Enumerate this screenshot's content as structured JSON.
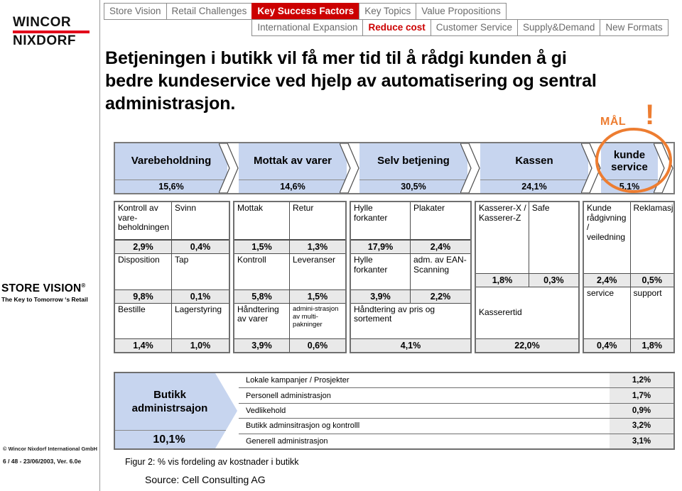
{
  "brand": {
    "logo_line1": "WINCOR",
    "logo_line2": "NIXDORF",
    "store_vision": "STORE VISION",
    "store_vision_mark": "®",
    "store_vision_tagline": "The Key to Tomorrow ‘s Retail",
    "copyright": "© Wincor Nixdorf International GmbH",
    "version": "6 / 48 - 23/06/2003, Ver. 6.0e",
    "accent_red": "#cc0000",
    "accent_orange": "#ED7D31",
    "chevron_blue": "#c7d5ef"
  },
  "tabs": {
    "row1": [
      {
        "label": "Store Vision",
        "state": "normal"
      },
      {
        "label": "Retail Challenges",
        "state": "normal"
      },
      {
        "label": "Key Success Factors",
        "state": "active"
      },
      {
        "label": "Key Topics",
        "state": "normal"
      },
      {
        "label": "Value Propositions",
        "state": "normal"
      }
    ],
    "row2": [
      {
        "label": "International Expansion",
        "state": "normal"
      },
      {
        "label": "Reduce cost",
        "state": "active-text"
      },
      {
        "label": "Customer Service",
        "state": "normal"
      },
      {
        "label": "Supply&Demand",
        "state": "normal"
      },
      {
        "label": "New Formats",
        "state": "normal"
      }
    ]
  },
  "headline": "Betjeningen i butikk vil få mer tid til å rådgi kunden å gi bedre kundeservice ved hjelp av automatisering og sentral administrasjon.",
  "target": {
    "label": "MÅL",
    "exclamation": "!"
  },
  "chart_data": {
    "type": "bar",
    "title": "Figur 2: % vis fordeling av kostnader i butikk",
    "source": "Source: Cell Consulting AG",
    "units": "percent of in-store cost",
    "categories": [
      "Varebeholdning",
      "Mottak av varer",
      "Selv betjening",
      "Kassen",
      "kunde service",
      "Butikk administrsajon"
    ],
    "values": [
      15.6,
      14.6,
      30.5,
      24.1,
      5.1,
      10.1
    ],
    "value_labels": [
      "15,6%",
      "14,6%",
      "30,5%",
      "24,1%",
      "5,1%",
      "10,1%"
    ],
    "xlabel": "",
    "ylabel": "",
    "breakdown": [
      {
        "group": "Varebeholdning",
        "item": "Kontroll av vare-beholdningen",
        "value": 2.9,
        "label": "2,9%"
      },
      {
        "group": "Varebeholdning",
        "item": "Svinn",
        "value": 0.4,
        "label": "0,4%"
      },
      {
        "group": "Varebeholdning",
        "item": "Disposition",
        "value": 9.8,
        "label": "9,8%"
      },
      {
        "group": "Varebeholdning",
        "item": "Tap",
        "value": 0.1,
        "label": "0,1%"
      },
      {
        "group": "Varebeholdning",
        "item": "Bestille",
        "value": 1.4,
        "label": "1,4%"
      },
      {
        "group": "Varebeholdning",
        "item": "Lagerstyring",
        "value": 1.0,
        "label": "1,0%"
      },
      {
        "group": "Mottak av varer",
        "item": "Mottak",
        "value": 1.5,
        "label": "1,5%"
      },
      {
        "group": "Mottak av varer",
        "item": "Retur",
        "value": 1.3,
        "label": "1,3%"
      },
      {
        "group": "Mottak av varer",
        "item": "Kontroll",
        "value": 5.8,
        "label": "5,8%"
      },
      {
        "group": "Mottak av varer",
        "item": "Leveranser",
        "value": 1.5,
        "label": "1,5%"
      },
      {
        "group": "Mottak av varer",
        "item": "Håndtering av varer",
        "value": 3.9,
        "label": "3,9%"
      },
      {
        "group": "Mottak av varer",
        "item": "admini-strasjon av multi-pakninger",
        "value": 0.6,
        "label": "0,6%"
      },
      {
        "group": "Selv betjening",
        "item": "Hylle forkanter",
        "value": 17.9,
        "label": "17,9%"
      },
      {
        "group": "Selv betjening",
        "item": "Plakater",
        "value": 2.4,
        "label": "2,4%"
      },
      {
        "group": "Selv betjening",
        "item": "Hylle forkanter",
        "value": 3.9,
        "label": "3,9%"
      },
      {
        "group": "Selv betjening",
        "item": "adm. av EAN-Scanning",
        "value": 2.2,
        "label": "2,2%"
      },
      {
        "group": "Selv betjening",
        "item": "Håndtering av pris og sortement",
        "value": 4.1,
        "label": "4,1%"
      },
      {
        "group": "Kassen",
        "item": "Kasserer-X / Kasserer-Z",
        "value": 1.8,
        "label": "1,8%"
      },
      {
        "group": "Kassen",
        "item": "Safe",
        "value": 0.3,
        "label": "0,3%"
      },
      {
        "group": "Kassen",
        "item": "Kasserertid",
        "value": 22.0,
        "label": "22,0%"
      },
      {
        "group": "kunde service",
        "item": "Kunde rådgivning / veiledning",
        "value": 2.4,
        "label": "2,4%"
      },
      {
        "group": "kunde service",
        "item": "Reklamasjoner",
        "value": 0.5,
        "label": "0,5%"
      },
      {
        "group": "kunde service",
        "item": "service",
        "value": 0.4,
        "label": "0,4%"
      },
      {
        "group": "kunde service",
        "item": "support",
        "value": 1.8,
        "label": "1,8%"
      },
      {
        "group": "Butikk administrsajon",
        "item": "Lokale kampanjer  / Prosjekter",
        "value": 1.2,
        "label": "1,2%"
      },
      {
        "group": "Butikk administrsajon",
        "item": "Personell administrasjon",
        "value": 1.7,
        "label": "1,7%"
      },
      {
        "group": "Butikk administrsajon",
        "item": "Vedlikehold",
        "value": 0.9,
        "label": "0,9%"
      },
      {
        "group": "Butikk administrsajon",
        "item": "Butikk adminsitrasjon og kontrolll",
        "value": 3.2,
        "label": "3,2%"
      },
      {
        "group": "Butikk administrsajon",
        "item": "Generell administrasjon",
        "value": 3.1,
        "label": "3,1%"
      }
    ]
  },
  "band": [
    {
      "name": "Varebeholdning",
      "pct": "15,6%"
    },
    {
      "name": "Mottak av varer",
      "pct": "14,6%"
    },
    {
      "name": "Selv betjening",
      "pct": "30,5%"
    },
    {
      "name": "Kassen",
      "pct": "24,1%"
    },
    {
      "name": "kunde service",
      "pct": "5,1%"
    }
  ],
  "grid": {
    "g1": {
      "r1a": "Kontroll av vare-beholdningen",
      "r1b": "Svinn",
      "p1a": "2,9%",
      "p1b": "0,4%",
      "r2a": "Disposition",
      "r2b": "Tap",
      "p2a": "9,8%",
      "p2b": "0,1%",
      "r3a": "Bestille",
      "r3b": "Lagerstyring",
      "p3a": "1,4%",
      "p3b": "1,0%"
    },
    "g2": {
      "r1a": "Mottak",
      "r1b": "Retur",
      "p1a": "1,5%",
      "p1b": "1,3%",
      "r2a": "Kontroll",
      "r2b": "Leveranser",
      "p2a": "5,8%",
      "p2b": "1,5%",
      "r3a": "Håndtering av varer",
      "r3b": "admini-strasjon av multi-pakninger",
      "p3a": "3,9%",
      "p3b": "0,6%"
    },
    "g3": {
      "r1a": "Hylle forkanter",
      "r1b": "Plakater",
      "p1a": "17,9%",
      "p1b": "2,4%",
      "r2a": "Hylle forkanter",
      "r2b": "adm. av EAN-Scanning",
      "p2a": "3,9%",
      "p2b": "2,2%",
      "r3a": "Håndtering av pris og sortement",
      "p3a": "4,1%"
    },
    "g4": {
      "r1a": "Kasserer-X / Kasserer-Z",
      "r1b": "Safe",
      "p1a": "1,8%",
      "p1b": "0,3%",
      "r2a": "Kasserertid",
      "p2a": "22,0%"
    },
    "g5": {
      "r1a": "Kunde rådgivning / veiledning",
      "r1b": "Reklamasjoner",
      "p1a": "2,4%",
      "p1b": "0,5%",
      "r2a": "service",
      "r2b": "support",
      "p2a": "0,4%",
      "p2b": "1,8%"
    }
  },
  "admin": {
    "title": "Butikk administrsajon",
    "total": "10,1%",
    "rows": [
      {
        "label": "Lokale kampanjer  / Prosjekter",
        "pct": "1,2%"
      },
      {
        "label": "Personell administrasjon",
        "pct": "1,7%"
      },
      {
        "label": "Vedlikehold",
        "pct": "0,9%"
      },
      {
        "label": "Butikk adminsitrasjon og kontrolll",
        "pct": "3,2%"
      },
      {
        "label": "Generell administrasjon",
        "pct": "3,1%"
      }
    ]
  },
  "captions": {
    "figure": "Figur 2: %  vis fordeling av kostnader i butikk",
    "source": "Source: Cell Consulting AG"
  }
}
